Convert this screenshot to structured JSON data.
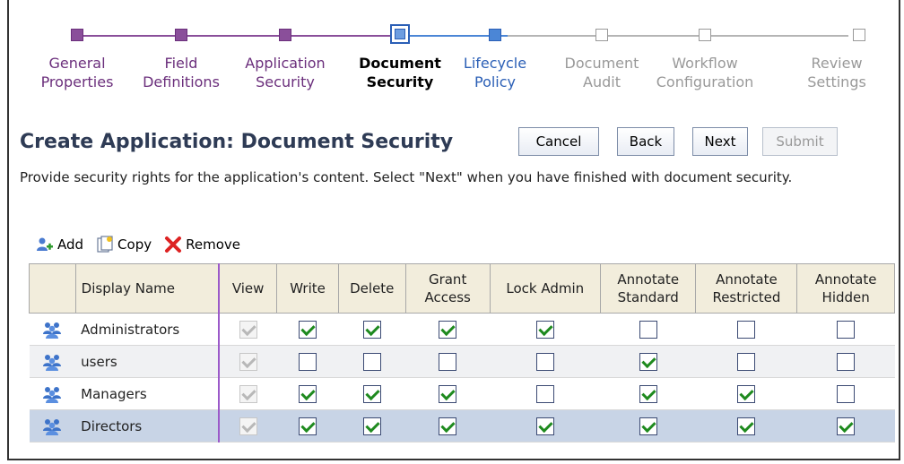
{
  "train": {
    "stops": [
      {
        "label": "General\nProperties",
        "state": "done"
      },
      {
        "label": "Field\nDefinitions",
        "state": "done"
      },
      {
        "label": "Application\nSecurity",
        "state": "done"
      },
      {
        "label": "Document\nSecurity",
        "state": "current"
      },
      {
        "label": "Lifecycle\nPolicy",
        "state": "next"
      },
      {
        "label": "Document\nAudit",
        "state": "todo"
      },
      {
        "label": "Workflow\nConfiguration",
        "state": "todo"
      },
      {
        "label": "Review\nSettings",
        "state": "todo"
      }
    ]
  },
  "header": {
    "title": "Create Application: Document Security",
    "buttons": {
      "cancel": "Cancel",
      "back": "Back",
      "next": "Next",
      "submit": "Submit"
    }
  },
  "instructions": "Provide security rights for the application's content. Select \"Next\" when you have finished with document security.",
  "toolbar": {
    "add": "Add",
    "copy": "Copy",
    "remove": "Remove"
  },
  "table": {
    "columns": [
      "Display Name",
      "View",
      "Write",
      "Delete",
      "Grant Access",
      "Lock Admin",
      "Annotate Standard",
      "Annotate Restricted",
      "Annotate Hidden"
    ],
    "rows": [
      {
        "name": "Administrators",
        "perms": [
          true,
          true,
          true,
          true,
          true,
          false,
          false,
          false
        ]
      },
      {
        "name": "users",
        "perms": [
          true,
          false,
          false,
          false,
          false,
          true,
          false,
          false
        ]
      },
      {
        "name": "Managers",
        "perms": [
          true,
          true,
          true,
          true,
          false,
          true,
          true,
          false
        ]
      },
      {
        "name": "Directors",
        "perms": [
          true,
          true,
          true,
          true,
          true,
          true,
          true,
          true
        ]
      }
    ],
    "selected_row": 3
  },
  "colors": {
    "done": "#8a4f9a",
    "current": "#2b5fb6",
    "todo": "#999999",
    "header_bg": "#f2eddc",
    "selected_row": "#c8d4e6"
  }
}
